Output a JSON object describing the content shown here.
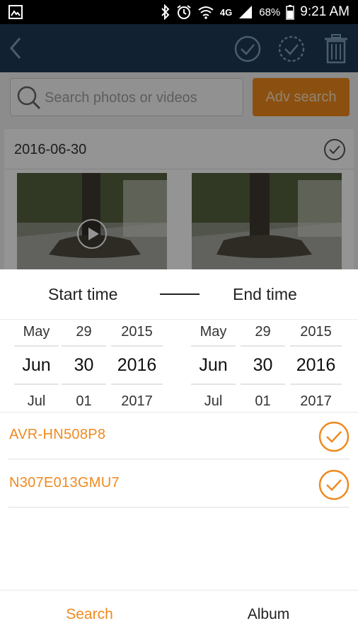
{
  "status_bar": {
    "network": "4G",
    "battery_percent": "68%",
    "time": "9:21 AM"
  },
  "toolbar": {
    "icons": [
      "back-icon",
      "check-circle-icon",
      "check-circle-icon",
      "trash-icon"
    ]
  },
  "search": {
    "placeholder": "Search photos or videos",
    "adv_button_label": "Adv search"
  },
  "gallery": {
    "date": "2016-06-30"
  },
  "date_range": {
    "start_label": "Start time",
    "end_label": "End time",
    "start": {
      "month": {
        "prev": "May",
        "current": "Jun",
        "next": "Jul"
      },
      "day": {
        "prev": "29",
        "current": "30",
        "next": "01"
      },
      "year": {
        "prev": "2015",
        "current": "2016",
        "next": "2017"
      }
    },
    "end": {
      "month": {
        "prev": "May",
        "current": "Jun",
        "next": "Jul"
      },
      "day": {
        "prev": "29",
        "current": "30",
        "next": "01"
      },
      "year": {
        "prev": "2015",
        "current": "2016",
        "next": "2017"
      }
    }
  },
  "devices": [
    {
      "name": "AVR-HN508P8",
      "selected": true
    },
    {
      "name": "N307E013GMU7",
      "selected": true
    }
  ],
  "tabs": {
    "search_label": "Search",
    "album_label": "Album"
  },
  "colors": {
    "accent": "#ef8a1f",
    "appbar": "#1e3a57",
    "overlay": "rgba(0,0,0,0.42)"
  }
}
